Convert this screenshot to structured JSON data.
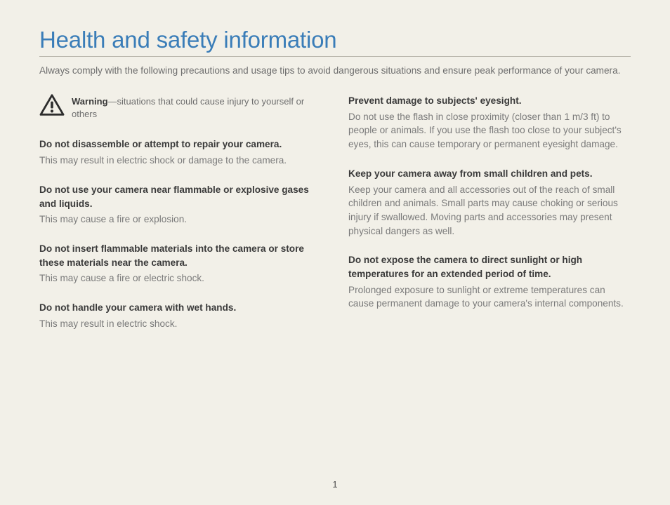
{
  "title": "Health and safety information",
  "intro": "Always comply with the following precautions and usage tips to avoid dangerous situations and ensure peak performance of your camera.",
  "warning": {
    "label": "Warning",
    "desc": "—situations that could cause injury to yourself or others"
  },
  "left_sections": [
    {
      "head": "Do not disassemble or attempt to repair your camera.",
      "body": "This may result in electric shock or damage to the camera."
    },
    {
      "head": "Do not use your camera near flammable or explosive gases and liquids.",
      "body": "This may cause a fire or explosion."
    },
    {
      "head": "Do not insert flammable materials into the camera or store these materials near the camera.",
      "body": "This may cause a fire or electric shock."
    },
    {
      "head": "Do not handle your camera with wet hands.",
      "body": "This may result in electric shock."
    }
  ],
  "right_sections": [
    {
      "head": "Prevent damage to subjects' eyesight.",
      "body": "Do not use the flash in close proximity (closer than 1 m/3 ft) to people or animals. If you use the flash too close to your subject's eyes, this can cause temporary or permanent eyesight damage."
    },
    {
      "head": "Keep your camera away from small children and pets.",
      "body": "Keep your camera and all accessories out of the reach of small children and animals. Small parts may cause choking or serious injury if swallowed. Moving parts and accessories may present physical dangers as well."
    },
    {
      "head": "Do not expose the camera to direct sunlight or high temperatures for an extended period of time.",
      "body": "Prolonged exposure to sunlight or extreme temperatures can cause permanent damage to your camera's internal components."
    }
  ],
  "page_number": "1"
}
